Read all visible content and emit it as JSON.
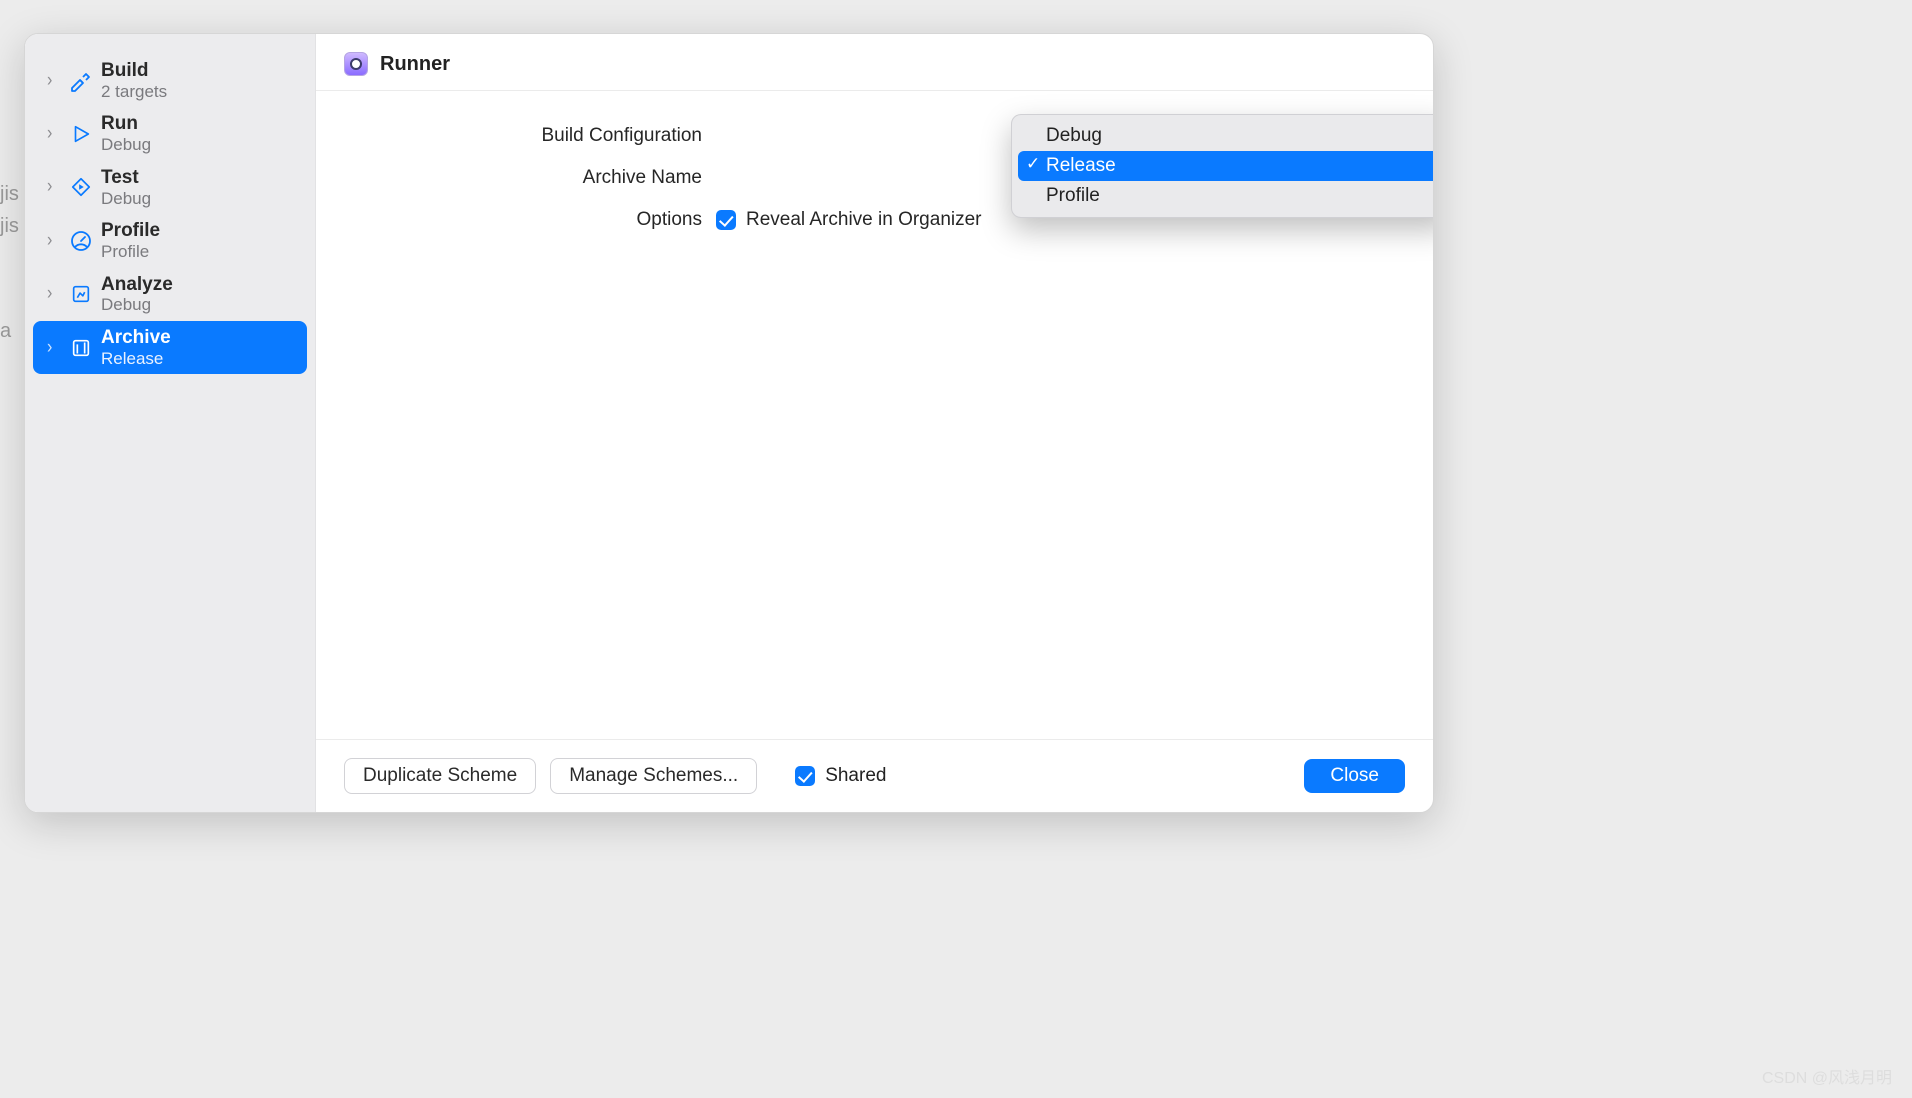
{
  "page_title": "Runner",
  "sidebar": {
    "items": [
      {
        "title": "Build",
        "subtitle": "2 targets",
        "icon": "hammer"
      },
      {
        "title": "Run",
        "subtitle": "Debug",
        "icon": "play"
      },
      {
        "title": "Test",
        "subtitle": "Debug",
        "icon": "diamond-play"
      },
      {
        "title": "Profile",
        "subtitle": "Profile",
        "icon": "gauge"
      },
      {
        "title": "Analyze",
        "subtitle": "Debug",
        "icon": "flow"
      },
      {
        "title": "Archive",
        "subtitle": "Release",
        "icon": "archive"
      }
    ],
    "selected_index": 5
  },
  "form": {
    "build_configuration": {
      "label": "Build Configuration"
    },
    "archive_name": {
      "label": "Archive Name"
    },
    "options": {
      "label": "Options",
      "checkbox_label": "Reveal Archive in Organizer",
      "checked": true
    }
  },
  "dropdown": {
    "items": [
      "Debug",
      "Release",
      "Profile"
    ],
    "selected_index": 1
  },
  "footer": {
    "duplicate": "Duplicate Scheme",
    "manage": "Manage Schemes...",
    "shared_label": "Shared",
    "shared_checked": true,
    "close": "Close"
  },
  "watermark": "CSDN @风浅月明",
  "colors": {
    "accent": "#0a7aff"
  }
}
